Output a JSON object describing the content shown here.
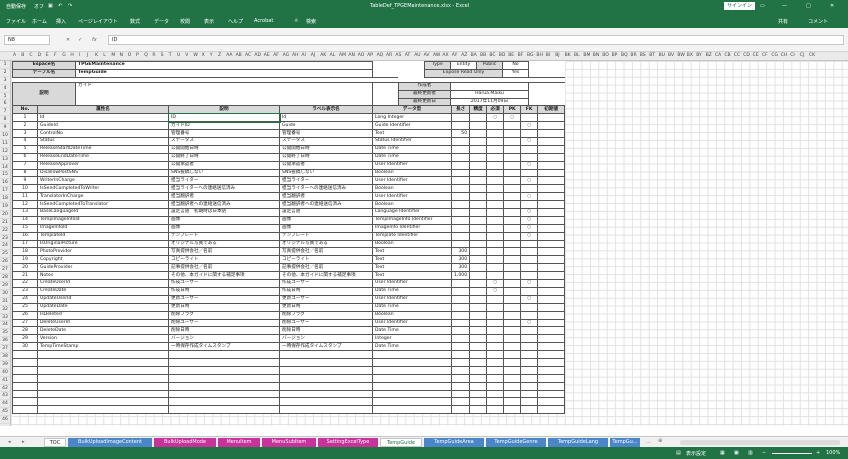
{
  "titlebar": {
    "autosave": "自動保存",
    "autosave_state": "オフ",
    "title": "TableDef_TPGEMaintenance.xlsx - Excel",
    "signin": "サインイン"
  },
  "ribbon": {
    "tabs": [
      "ファイル",
      "ホーム",
      "挿入",
      "ページレイアウト",
      "数式",
      "データ",
      "校閲",
      "表示",
      "ヘルプ",
      "Acrobat"
    ],
    "search": "検索",
    "share": "共有",
    "comment": "コメント"
  },
  "formula": {
    "cell_ref": "N8",
    "fx": "fx",
    "value": "ID"
  },
  "columns": [
    "A",
    "B",
    "C",
    "D",
    "E",
    "F",
    "G",
    "H",
    "I",
    "J",
    "K",
    "L",
    "M",
    "N",
    "O",
    "P",
    "Q",
    "R",
    "S",
    "T",
    "U",
    "V",
    "W",
    "X",
    "Y",
    "Z",
    "AA",
    "AB",
    "AC",
    "AD",
    "AE",
    "AF",
    "AG",
    "AH",
    "AI",
    "AJ",
    "AK",
    "AL",
    "AM",
    "AN",
    "AO",
    "AP",
    "AQ",
    "AR",
    "AS",
    "AT",
    "AU",
    "AV",
    "AW",
    "AX",
    "AY",
    "AZ",
    "BA",
    "BB",
    "BC",
    "BD",
    "BE",
    "BF",
    "BG",
    "BH",
    "BI",
    "BJ",
    "BK",
    "BL",
    "BM",
    "BN",
    "BO",
    "BP",
    "BQ",
    "BR",
    "BS",
    "BT",
    "BU",
    "BV",
    "BW",
    "BX",
    "BY",
    "BZ",
    "CA",
    "CB",
    "CC",
    "CD",
    "CE",
    "CF",
    "CG",
    "CH",
    "CI",
    "CJ",
    "CK"
  ],
  "rows": [
    "1",
    "2",
    "3",
    "4",
    "5",
    "6",
    "7",
    "8",
    "9",
    "10",
    "11",
    "12",
    "13",
    "14",
    "15",
    "16",
    "17",
    "18",
    "19",
    "20",
    "21",
    "22",
    "23",
    "24",
    "25",
    "26",
    "27",
    "28",
    "29",
    "30",
    "31",
    "32",
    "33",
    "34",
    "35",
    "36",
    "37",
    "38",
    "39",
    "40",
    "41",
    "42",
    "43",
    "44",
    "45",
    "46"
  ],
  "sheet": {
    "espace_label": "Espace名",
    "espace_value": "TPGEMaintenance",
    "table_label": "テーブル名",
    "table_value": "TempGuide",
    "desc_label": "説明",
    "desc_value": "ガイド",
    "info": {
      "type_label": "Type",
      "type_value": "Entity",
      "public_label": "Public",
      "public_value": "No",
      "expose_label": "Expose Read Only",
      "expose_value": "Yes",
      "creator_label": "作成者",
      "creator_value": "",
      "updater_label": "最終更新者",
      "updater_value": "Harua.Maiku",
      "updated_label": "最終更新日",
      "updated_value": "2017年11月09日"
    },
    "headers": {
      "no": "No.",
      "name": "属性名",
      "desc": "説明",
      "label": "ラベル表示名",
      "type": "データ型",
      "len": "長さ",
      "dec": "精度",
      "req": "必須",
      "pk": "PK",
      "fk": "FK",
      "init": "初期値"
    },
    "attributes": [
      {
        "no": "1",
        "name": "Id",
        "desc": "ID",
        "label": "Id",
        "type": "Long Integer",
        "len": "",
        "req": "○",
        "pk": "○",
        "fk": ""
      },
      {
        "no": "2",
        "name": "GuideId",
        "desc": "ガイドID",
        "label": "Guide",
        "type": "Guide Identifier",
        "len": "",
        "req": "",
        "pk": "",
        "fk": "○"
      },
      {
        "no": "3",
        "name": "ControlNo",
        "desc": "管理番号",
        "label": "管理番号",
        "type": "Text",
        "len": "50",
        "req": "",
        "pk": "",
        "fk": ""
      },
      {
        "no": "4",
        "name": "Status",
        "desc": "ステータス",
        "label": "ステータス",
        "type": "Status Identifier",
        "len": "",
        "req": "",
        "pk": "",
        "fk": "○"
      },
      {
        "no": "5",
        "name": "ReleaseStartDateTime",
        "desc": "公開開始日時",
        "label": "公開開始日時",
        "type": "Date Time",
        "len": "",
        "req": "",
        "pk": "",
        "fk": ""
      },
      {
        "no": "6",
        "name": "ReleaseEndDateTime",
        "desc": "公開終了日時",
        "label": "公開終了日時",
        "type": "Date Time",
        "len": "",
        "req": "",
        "pk": "",
        "fk": ""
      },
      {
        "no": "7",
        "name": "ReleaseApprover",
        "desc": "公開承認者",
        "label": "公開承認者",
        "type": "User Identifier",
        "len": "",
        "req": "",
        "pk": "",
        "fk": "○"
      },
      {
        "no": "8",
        "name": "DisallowPostSNS",
        "desc": "SNS投稿しない",
        "label": "SNS投稿しない",
        "type": "Boolean",
        "len": "",
        "req": "",
        "pk": "",
        "fk": ""
      },
      {
        "no": "9",
        "name": "WriterInCharge",
        "desc": "担当ライター",
        "label": "担当ライター",
        "type": "User Identifier",
        "len": "",
        "req": "",
        "pk": "",
        "fk": "○"
      },
      {
        "no": "10",
        "name": "IsSendCompletedToWriter",
        "desc": "担当ライターへの連絡送信済み",
        "label": "担当ライターへの連絡送信済み",
        "type": "Boolean",
        "len": "",
        "req": "",
        "pk": "",
        "fk": ""
      },
      {
        "no": "11",
        "name": "TranslatorInCharge",
        "desc": "担当翻訳者",
        "label": "担当翻訳者",
        "type": "User Identifier",
        "len": "",
        "req": "",
        "pk": "",
        "fk": "○"
      },
      {
        "no": "12",
        "name": "IsSendCompletedToTranslator",
        "desc": "担当翻訳者への連絡送信済み",
        "label": "担当翻訳者への連絡送信済み",
        "type": "Boolean",
        "len": "",
        "req": "",
        "pk": "",
        "fk": ""
      },
      {
        "no": "13",
        "name": "BaseLanguageId",
        "desc": "設定言語　初期時は日本語",
        "label": "設定言語",
        "type": "Language Identifier",
        "len": "",
        "req": "",
        "pk": "",
        "fk": "○"
      },
      {
        "no": "14",
        "name": "TempImageInfoId",
        "desc": "画像",
        "label": "画像",
        "type": "TempImageInfo Identifier",
        "len": "",
        "req": "",
        "pk": "",
        "fk": "○"
      },
      {
        "no": "15",
        "name": "ImageInfoId",
        "desc": "画像",
        "label": "画像",
        "type": "ImageInfo Identifier",
        "len": "",
        "req": "",
        "pk": "",
        "fk": "○"
      },
      {
        "no": "16",
        "name": "TemplateId",
        "desc": "テンプレート",
        "label": "テンプレート",
        "type": "Template Identifier",
        "len": "",
        "req": "",
        "pk": "",
        "fk": "○"
      },
      {
        "no": "17",
        "name": "IsOriginalPicture",
        "desc": "オリジナル写真である",
        "label": "オリジナル写真である",
        "type": "Boolean",
        "len": "",
        "req": "",
        "pk": "",
        "fk": ""
      },
      {
        "no": "18",
        "name": "PhotoProvider",
        "desc": "写真提供会社／名前",
        "label": "写真提供会社／名前",
        "type": "Text",
        "len": "300",
        "req": "",
        "pk": "",
        "fk": ""
      },
      {
        "no": "19",
        "name": "Copyright",
        "desc": "コピーライト",
        "label": "コピーライト",
        "type": "Text",
        "len": "300",
        "req": "",
        "pk": "",
        "fk": ""
      },
      {
        "no": "20",
        "name": "GuideProvider",
        "desc": "記事提供会社／名前",
        "label": "記事提供会社／名前",
        "type": "Text",
        "len": "300",
        "req": "",
        "pk": "",
        "fk": ""
      },
      {
        "no": "21",
        "name": "Notes",
        "desc": "その他、本ガイドに関する補足事項",
        "label": "その他、本ガイドに関する補足事項",
        "type": "Text",
        "len": "1,000",
        "req": "",
        "pk": "",
        "fk": ""
      },
      {
        "no": "22",
        "name": "CreateUserId",
        "desc": "作成ユーザー",
        "label": "作成ユーザー",
        "type": "User Identifier",
        "len": "",
        "req": "○",
        "pk": "",
        "fk": "○"
      },
      {
        "no": "23",
        "name": "CreateDate",
        "desc": "作成日時",
        "label": "作成日時",
        "type": "Date Time",
        "len": "",
        "req": "○",
        "pk": "",
        "fk": ""
      },
      {
        "no": "24",
        "name": "UpdateUserId",
        "desc": "更新ユーザー",
        "label": "更新ユーザー",
        "type": "User Identifier",
        "len": "",
        "req": "",
        "pk": "",
        "fk": "○"
      },
      {
        "no": "25",
        "name": "UpdateDate",
        "desc": "更新日時",
        "label": "更新日時",
        "type": "Date Time",
        "len": "",
        "req": "",
        "pk": "",
        "fk": ""
      },
      {
        "no": "26",
        "name": "IsDeleted",
        "desc": "削除フラグ",
        "label": "削除フラグ",
        "type": "Boolean",
        "len": "",
        "req": "",
        "pk": "",
        "fk": ""
      },
      {
        "no": "27",
        "name": "DeleteUserId",
        "desc": "削除ユーザー",
        "label": "削除ユーザー",
        "type": "User Identifier",
        "len": "",
        "req": "",
        "pk": "",
        "fk": "○"
      },
      {
        "no": "28",
        "name": "DeleteDate",
        "desc": "削除日時",
        "label": "削除日時",
        "type": "Date Time",
        "len": "",
        "req": "",
        "pk": "",
        "fk": ""
      },
      {
        "no": "29",
        "name": "Version",
        "desc": "バージョン",
        "label": "バージョン",
        "type": "Integer",
        "len": "",
        "req": "",
        "pk": "",
        "fk": ""
      },
      {
        "no": "30",
        "name": "TempTimeStamp",
        "desc": "一時保存作成タイムスタンプ",
        "label": "一時保存作成タイムスタンプ",
        "type": "Date Time",
        "len": "",
        "req": "",
        "pk": "",
        "fk": ""
      }
    ]
  },
  "tabs": [
    {
      "label": "TOC",
      "color": "#ffffff",
      "text": "#222"
    },
    {
      "label": "BulkUploadImageContent",
      "color": "#4a86c8",
      "text": "#fff"
    },
    {
      "label": "BulkUploadMode",
      "color": "#c8329b",
      "text": "#fff"
    },
    {
      "label": "MenuItem",
      "color": "#c8329b",
      "text": "#fff"
    },
    {
      "label": "MenuSubItem",
      "color": "#c8329b",
      "text": "#fff"
    },
    {
      "label": "SettingExcelType",
      "color": "#c8329b",
      "text": "#fff"
    },
    {
      "label": "TempGuide",
      "color": "#ffffff",
      "text": "#217346"
    },
    {
      "label": "TempGuideArea",
      "color": "#4a86c8",
      "text": "#fff"
    },
    {
      "label": "TempGuideGenre",
      "color": "#4a86c8",
      "text": "#fff"
    },
    {
      "label": "TempGuideLang",
      "color": "#4a86c8",
      "text": "#fff"
    },
    {
      "label": "TempGu...",
      "color": "#4a86c8",
      "text": "#fff"
    }
  ],
  "status": {
    "ready": "",
    "view_setting": "表示設定",
    "zoom": "100%"
  }
}
